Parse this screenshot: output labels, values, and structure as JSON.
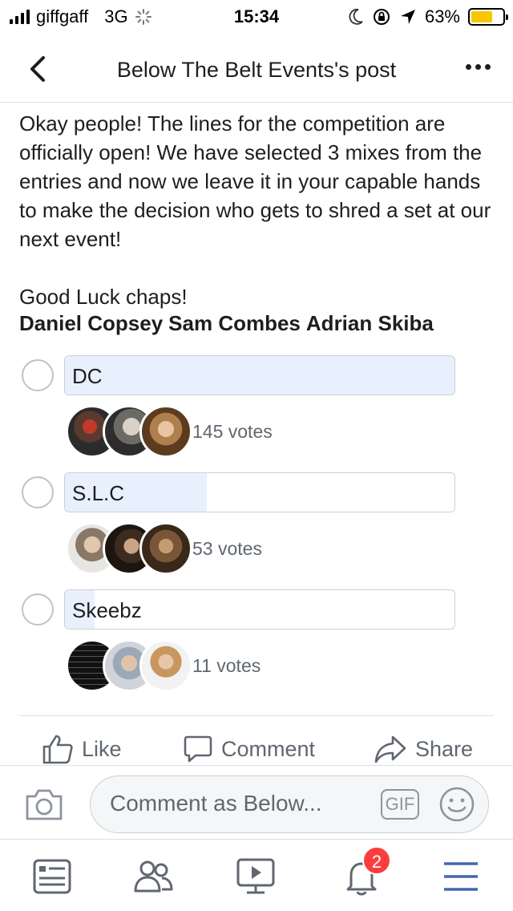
{
  "status_bar": {
    "carrier": "giffgaff",
    "network": "3G",
    "time": "15:34",
    "battery_percent": "63%",
    "battery_level": 0.63
  },
  "header": {
    "title": "Below The Belt Events's post"
  },
  "post": {
    "paragraphs": [
      "Okay people! The lines for the competition are officially open! We have selected 3 mixes from the entries and now we leave it in your capable hands to make the decision who gets to shred a set at our next event!",
      "Good Luck chaps!"
    ],
    "tags": [
      "Daniel Copsey",
      "Sam Combes",
      "Adrian Skiba"
    ]
  },
  "poll": {
    "options": [
      {
        "label": "DC",
        "votes": "145 votes",
        "vote_count": 145,
        "share": 1.0
      },
      {
        "label": "S.L.C",
        "votes": "53 votes",
        "vote_count": 53,
        "share": 0.365
      },
      {
        "label": "Skeebz",
        "votes": "11 votes",
        "vote_count": 11,
        "share": 0.076
      }
    ]
  },
  "actions": {
    "like": "Like",
    "comment": "Comment",
    "share": "Share"
  },
  "composer": {
    "placeholder": "Comment as Below...",
    "gif_label": "GIF"
  },
  "tab_bar": {
    "notifications_badge": "2"
  },
  "colors": {
    "brand_blue": "#4267b2",
    "poll_fill": "#e9f0fd",
    "badge_red": "#fa3e3e",
    "battery_yellow": "#f7c600"
  }
}
